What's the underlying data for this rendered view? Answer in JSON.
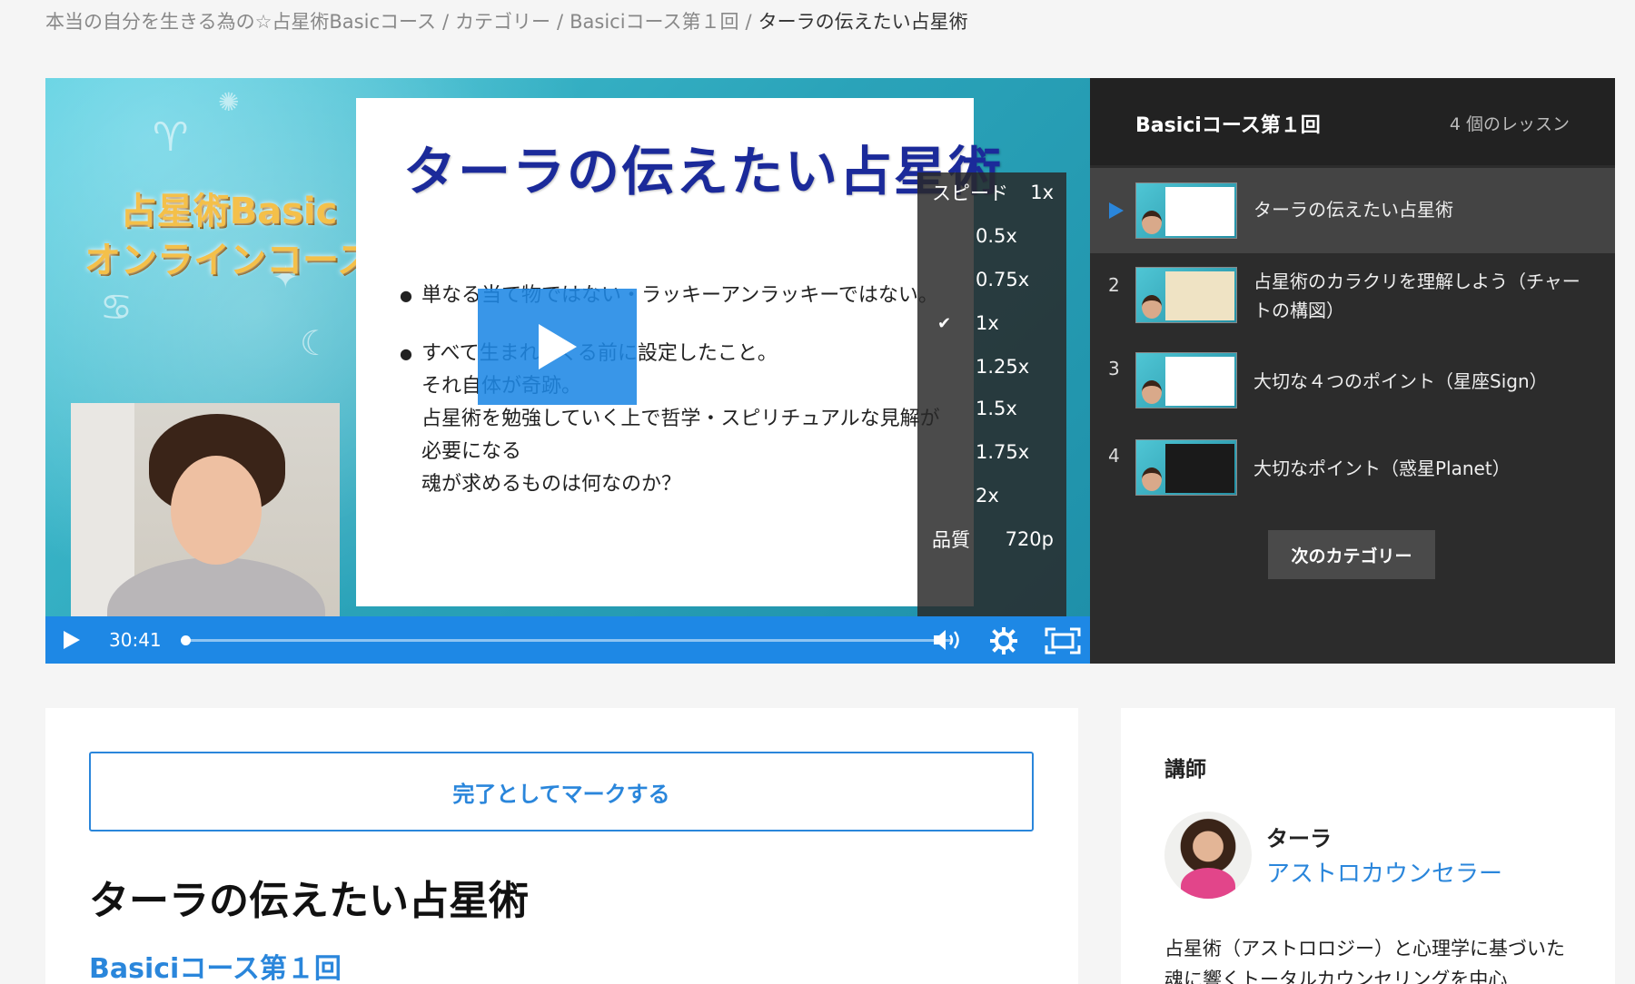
{
  "breadcrumb": {
    "items": [
      "本当の自分を生きる為の☆占星術Basicコース",
      "カテゴリー",
      "Basiciコース第１回",
      "ターラの伝えたい占星術"
    ],
    "separator": "/"
  },
  "player": {
    "slide": {
      "logo_line1": "占星術Basic",
      "logo_line2": "オンラインコース",
      "title": "ターラの伝えたい占星術",
      "bullet1": "単なる当て物ではない・ラッキーアンラッキーではない。",
      "bullet2": "すべて生まれてくる前に設定したこと。",
      "line3": "それ自体が奇跡。",
      "line4": "占星術を勉強していく上で哲学・スピリチュアルな見解が",
      "line5": "必要になる",
      "line6": "魂が求めるものは何なのか？"
    },
    "settings": {
      "speed_label": "スピード",
      "speed_value": "1x",
      "speed_options": [
        "0.5x",
        "0.75x",
        "1x",
        "1.25x",
        "1.5x",
        "1.75x",
        "2x"
      ],
      "selected_speed": "1x",
      "quality_label": "品質",
      "quality_value": "720p"
    },
    "controls": {
      "time": "30:41",
      "progress": 0.005
    }
  },
  "playlist": {
    "title": "Basiciコース第１回",
    "count": "4 個のレッスン",
    "lessons": [
      {
        "num": "",
        "label": "ターラの伝えたい占星術",
        "active": true
      },
      {
        "num": "2",
        "label": "占星術のカラクリを理解しよう（チャートの構図）"
      },
      {
        "num": "3",
        "label": "大切な４つのポイント（星座Sign）"
      },
      {
        "num": "4",
        "label": "大切なポイント（惑星Planet）"
      }
    ],
    "next_category": "次のカテゴリー"
  },
  "main": {
    "mark_complete": "完了としてマークする",
    "lesson_title": "ターラの伝えたい占星術",
    "lesson_subtitle": "Basiciコース第１回"
  },
  "instructor": {
    "heading": "講師",
    "name": "ターラ",
    "role": "アストロカウンセラー",
    "bio": "占星術（アストロロジー）と心理学に基づいた 魂に響くトータルカウンセリングを中心"
  },
  "colors": {
    "accent": "#2a86db",
    "player_bar": "#1e88e5",
    "sidebar_bg": "#2c2c2c"
  }
}
